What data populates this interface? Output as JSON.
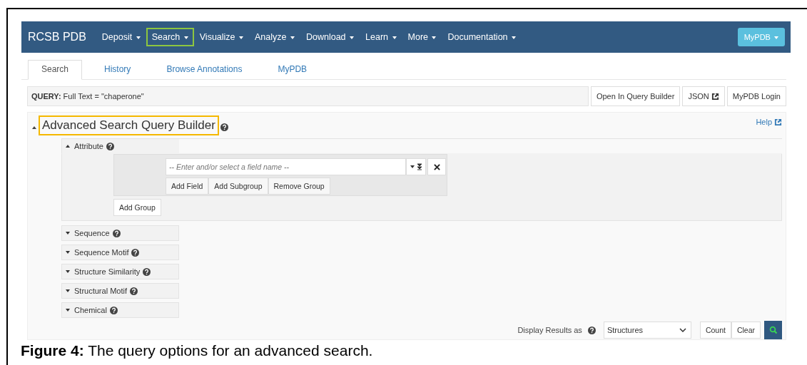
{
  "navbar": {
    "brand": "RCSB PDB",
    "items": [
      {
        "label": "Deposit",
        "highlighted": false
      },
      {
        "label": "Search",
        "highlighted": true
      },
      {
        "label": "Visualize",
        "highlighted": false
      },
      {
        "label": "Analyze",
        "highlighted": false
      },
      {
        "label": "Download",
        "highlighted": false
      },
      {
        "label": "Learn",
        "highlighted": false
      },
      {
        "label": "More",
        "highlighted": false
      },
      {
        "label": "Documentation",
        "highlighted": false
      }
    ],
    "user_button": "MyPDB"
  },
  "tabs": [
    {
      "label": "Search",
      "selected": true
    },
    {
      "label": "History",
      "selected": false
    },
    {
      "label": "Browse Annotations",
      "selected": false
    },
    {
      "label": "MyPDB",
      "selected": false
    }
  ],
  "query": "**QUERY:** Full Text = \"chaperone\"",
  "query_buttons": [
    {
      "label": "Open In Query Builder",
      "kind": "plain"
    },
    {
      "label": "JSON",
      "kind": "external"
    },
    {
      "label": "MyPDB Login",
      "kind": "plain"
    }
  ],
  "builder": {
    "title": "Advanced Search Query Builder",
    "highlighted": true,
    "expanded": true,
    "help_link": "Help",
    "sections": [
      {
        "label": "Attribute",
        "expanded": true
      },
      {
        "label": "Sequence",
        "expanded": false
      },
      {
        "label": "Sequence Motif",
        "expanded": false
      },
      {
        "label": "Structure Similarity",
        "expanded": false
      },
      {
        "label": "Structural Motif",
        "expanded": false
      },
      {
        "label": "Chemical",
        "expanded": false
      }
    ],
    "field_placeholder": "-- Enter and/or select a field name --",
    "group_buttons": [
      "Add Field",
      "Add Subgroup",
      "Remove Group"
    ],
    "add_group_button": "Add Group",
    "display_label": "Display Results as",
    "display_value": "Structures",
    "action_buttons": [
      "Count",
      "Clear"
    ]
  },
  "caption": "**Figure 4:** The query options for an advanced search."
}
